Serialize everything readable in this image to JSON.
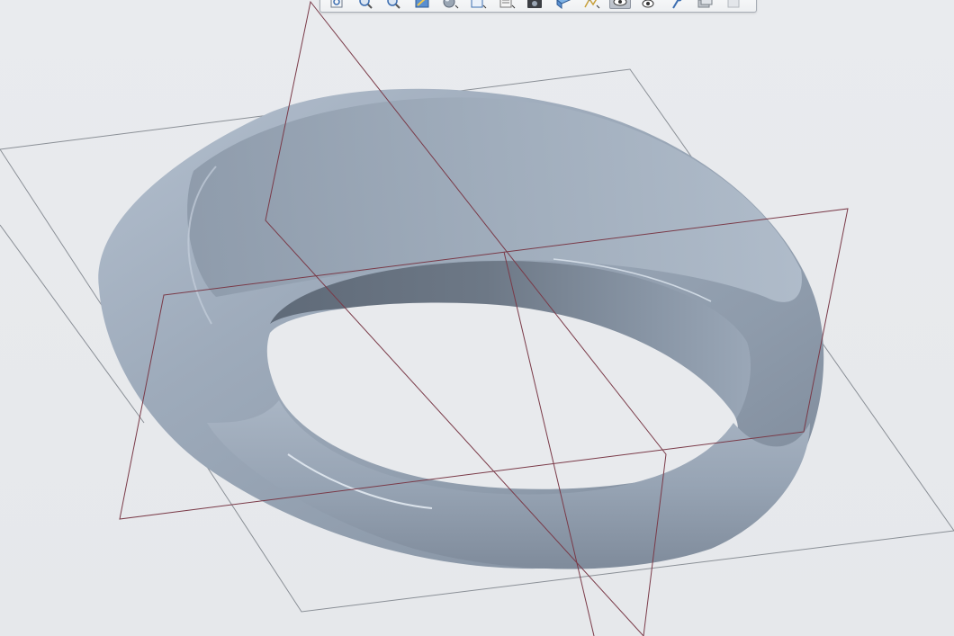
{
  "viewport": {
    "background": "#e8eaed",
    "model": "ring-surface",
    "model_color": "#a3afbe",
    "datum_plane_color": "#7a3a48",
    "datum_plane_secondary_color": "#8a8f96"
  },
  "toolbar": {
    "buttons": [
      {
        "icon": "refit-icon"
      },
      {
        "icon": "zoom-in-icon"
      },
      {
        "icon": "zoom-out-icon"
      },
      {
        "icon": "repaint-icon"
      },
      {
        "icon": "display-style-icon"
      },
      {
        "icon": "saved-orientations-icon"
      },
      {
        "icon": "view-manager-icon"
      },
      {
        "icon": "camera-icon"
      },
      {
        "icon": "perspective-icon"
      },
      {
        "icon": "datum-display-icon"
      },
      {
        "icon": "annotation-display-icon",
        "active": true
      },
      {
        "icon": "eye-icon"
      },
      {
        "icon": "spin-center-icon"
      },
      {
        "icon": "layers-icon"
      },
      {
        "icon": "section-icon"
      }
    ]
  }
}
